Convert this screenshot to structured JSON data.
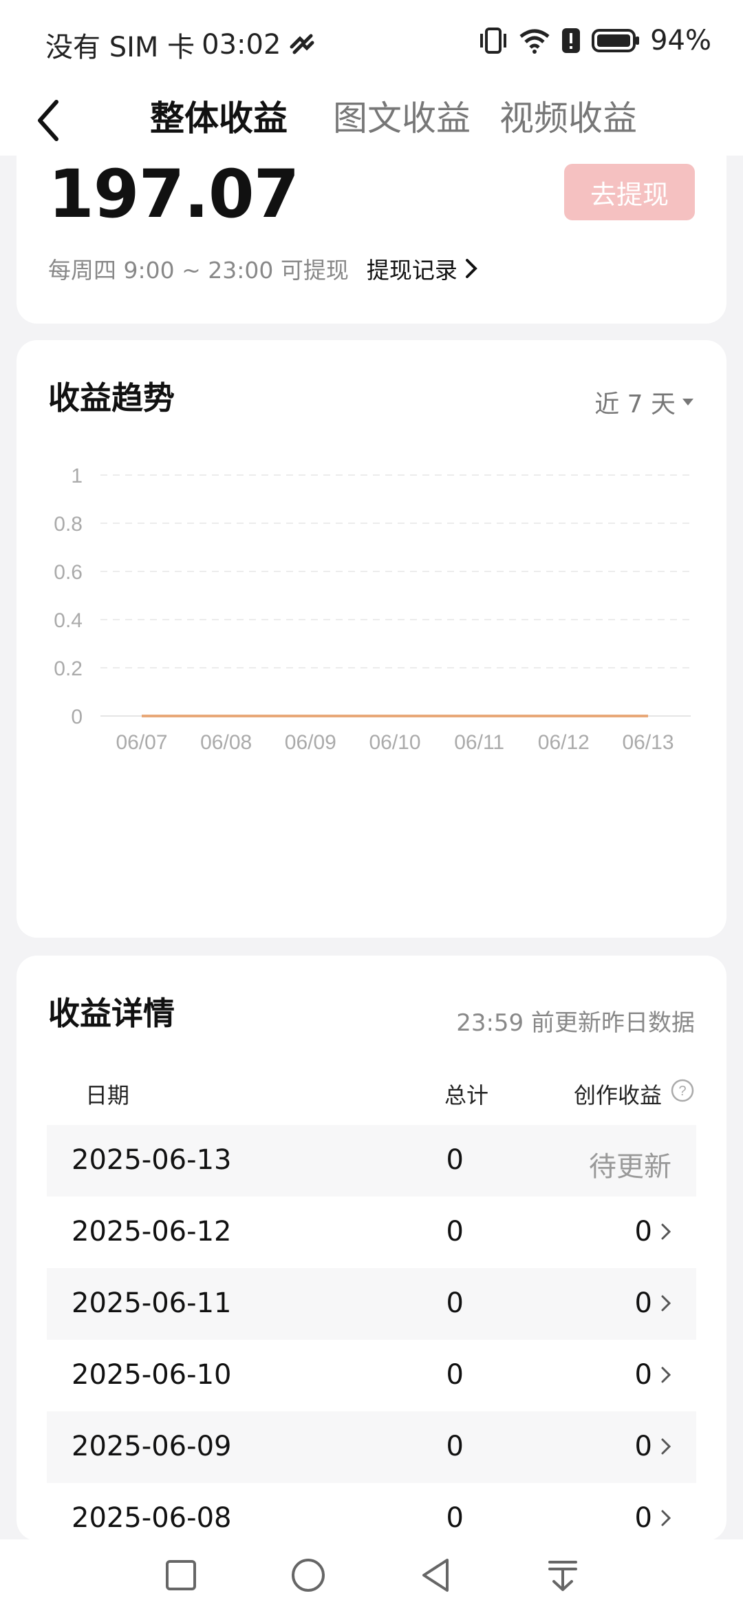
{
  "status_bar": {
    "carrier": "没有 SIM 卡",
    "time": "03:02",
    "battery": "94%"
  },
  "nav": {
    "tabs": [
      {
        "label": "整体收益",
        "active": true
      },
      {
        "label": "图文收益",
        "active": false
      },
      {
        "label": "视频收益",
        "active": false
      }
    ]
  },
  "balance": {
    "amount": "197.07",
    "withdraw_label": "去提现",
    "schedule": "每周四 9:00 ~ 23:00 可提现",
    "records_label": "提现记录"
  },
  "trend": {
    "title": "收益趋势",
    "range": "近 7 天"
  },
  "chart_data": {
    "type": "line",
    "title": "",
    "categories": [
      "06/07",
      "06/08",
      "06/09",
      "06/10",
      "06/11",
      "06/12",
      "06/13"
    ],
    "series": [
      {
        "values": [
          0,
          0,
          0,
          0,
          0,
          0,
          0
        ],
        "color": "#e8a878"
      }
    ],
    "y_ticks": [
      "1",
      "0.8",
      "0.6",
      "0.4",
      "0.2",
      "0"
    ],
    "ylim": [
      0,
      1
    ],
    "grid": true
  },
  "details": {
    "title": "收益详情",
    "update_note": "23:59 前更新昨日数据",
    "columns": [
      "日期",
      "总计",
      "创作收益"
    ],
    "rows": [
      {
        "date": "2025-06-13",
        "total": "0",
        "income": "待更新",
        "pending": true
      },
      {
        "date": "2025-06-12",
        "total": "0",
        "income": "0",
        "pending": false
      },
      {
        "date": "2025-06-11",
        "total": "0",
        "income": "0",
        "pending": false
      },
      {
        "date": "2025-06-10",
        "total": "0",
        "income": "0",
        "pending": false
      },
      {
        "date": "2025-06-09",
        "total": "0",
        "income": "0",
        "pending": false
      },
      {
        "date": "2025-06-08",
        "total": "0",
        "income": "0",
        "pending": false
      }
    ]
  },
  "system_nav": [
    "recent-apps-icon",
    "home-icon",
    "back-icon",
    "notification-pull-icon"
  ]
}
